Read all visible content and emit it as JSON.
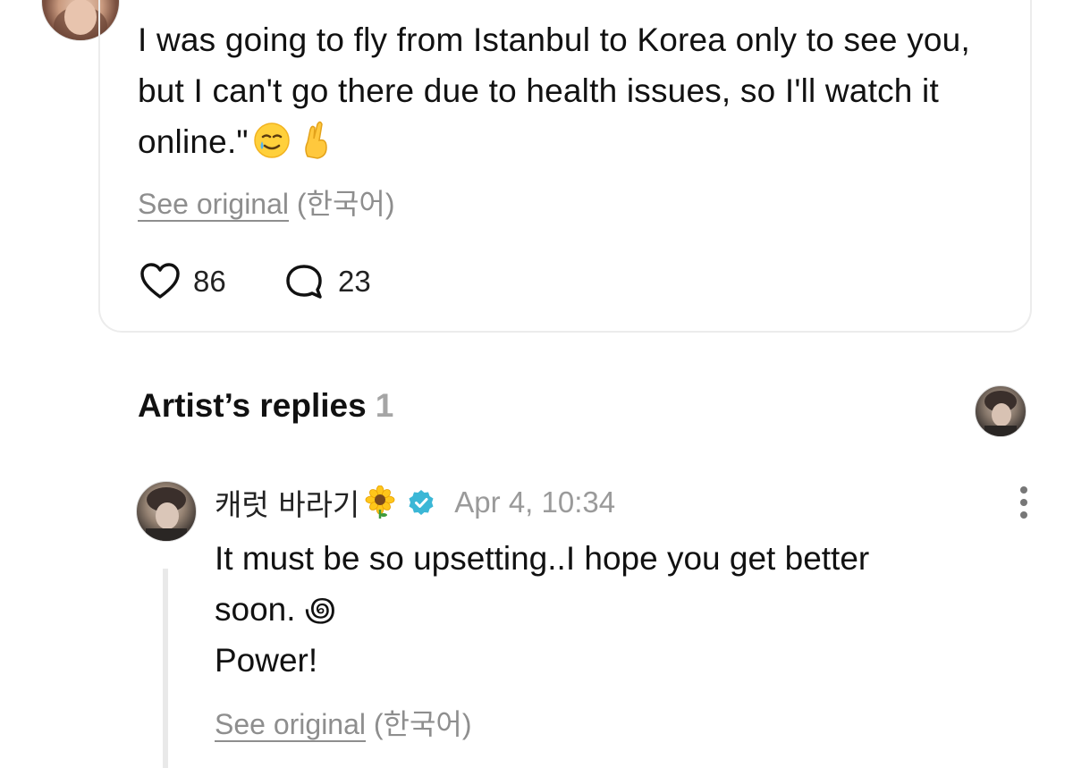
{
  "comment": {
    "text": "I was going to fly from Istanbul to Korea only to see you, but I can't go there due to health issues, so I'll watch it online.\"",
    "emojis": [
      "smiling-face-with-tear-icon",
      "crossed-fingers-icon"
    ],
    "see_original_label": "See original",
    "original_language": "(한국어)",
    "likes": "86",
    "replies": "23"
  },
  "artist_replies": {
    "title": "Artist’s replies",
    "count": "1"
  },
  "reply": {
    "author": "캐럿 바라기",
    "author_emoji": "sunflower-icon",
    "verified": true,
    "timestamp": "Apr 4, 10:34",
    "lines": [
      "It must be so upsetting..I hope you get better",
      "soon. ꩜",
      "Power!"
    ],
    "see_original_label": "See original",
    "original_language": "(한국어)"
  },
  "colors": {
    "verified_badge": "#3bb7d6",
    "muted_text": "#8e8e8e",
    "card_border": "#ececec"
  }
}
